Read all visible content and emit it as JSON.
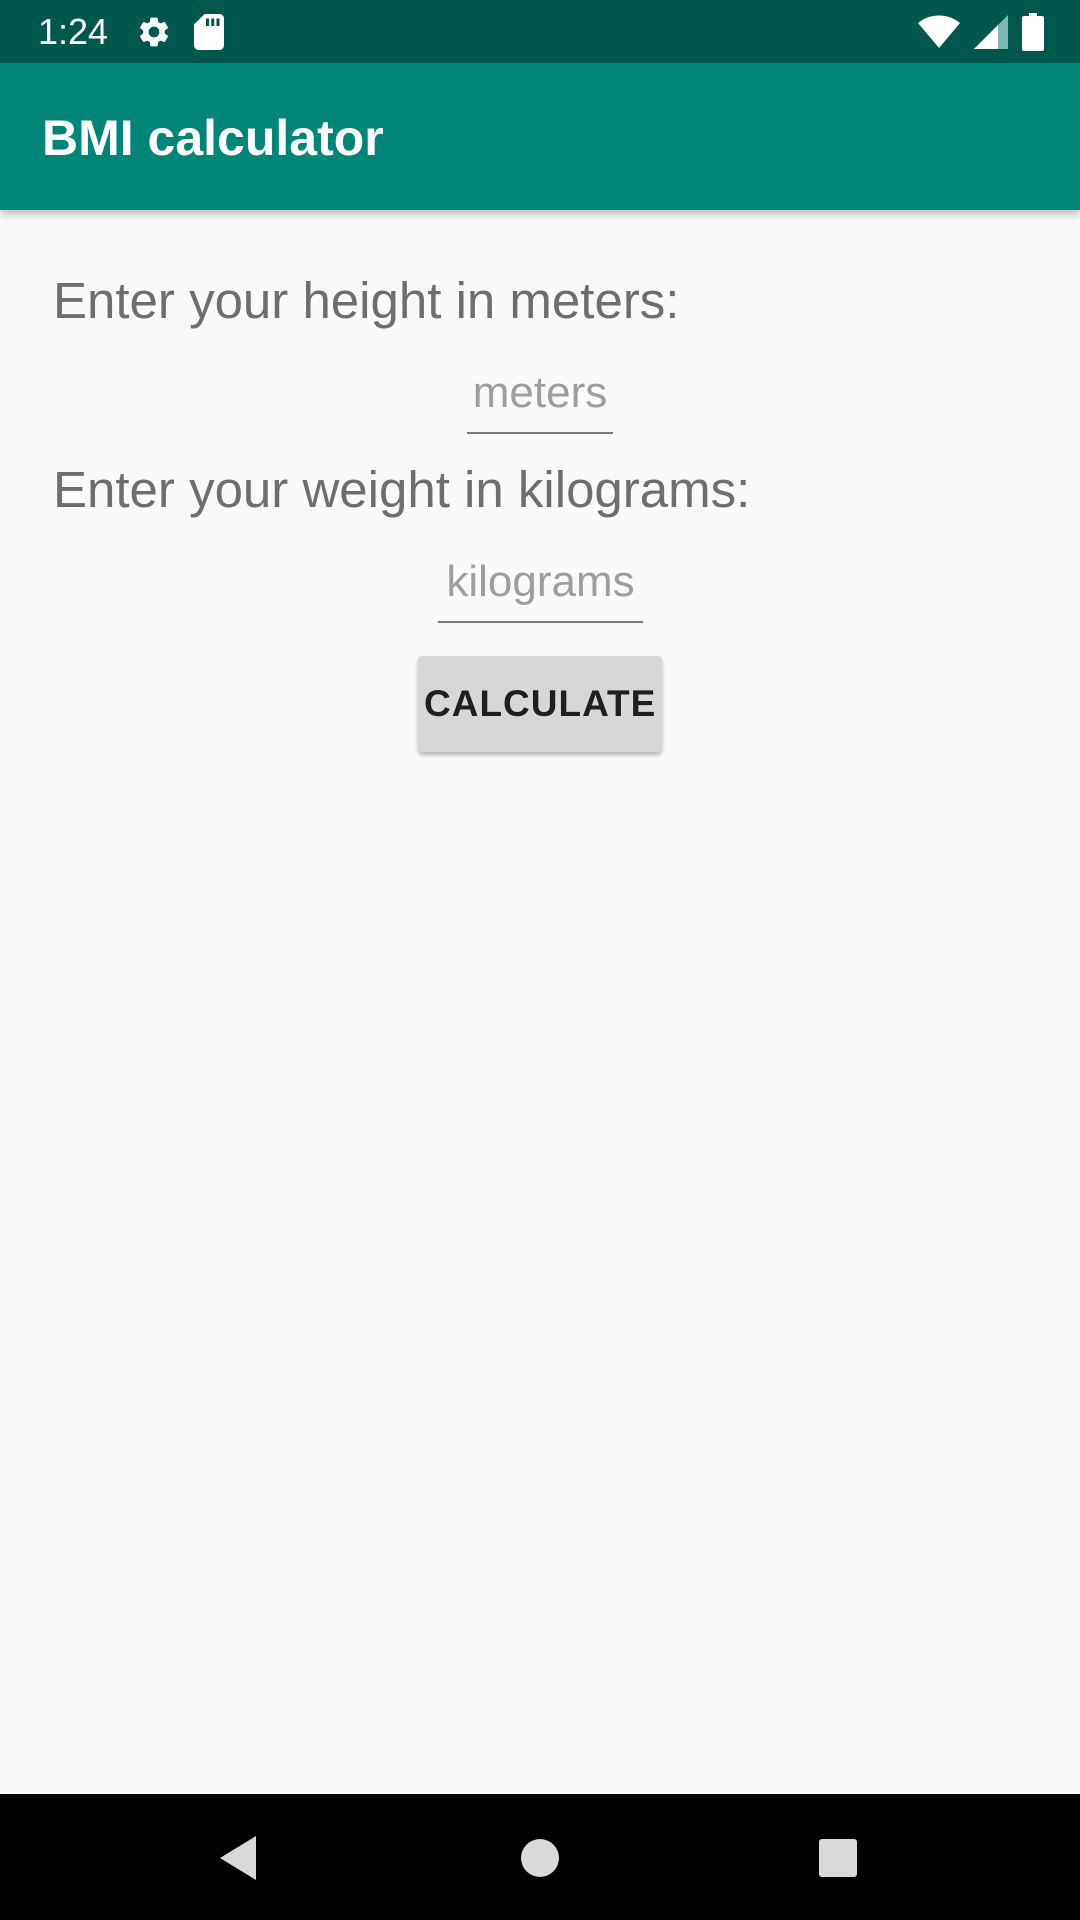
{
  "status_bar": {
    "time": "1:24",
    "icons": [
      "settings-icon",
      "sd-card-icon",
      "wifi-icon",
      "signal-icon",
      "battery-icon"
    ],
    "background": "#00574b"
  },
  "app_bar": {
    "title": "BMI calculator",
    "background": "#008577"
  },
  "form": {
    "height_label": "Enter your height in meters:",
    "height_placeholder": "meters",
    "weight_label": "Enter your weight in kilograms:",
    "weight_placeholder": "kilograms",
    "calculate_label": "CALCULATE"
  },
  "nav_bar": {
    "buttons": [
      "back-icon",
      "home-icon",
      "recents-icon"
    ]
  }
}
